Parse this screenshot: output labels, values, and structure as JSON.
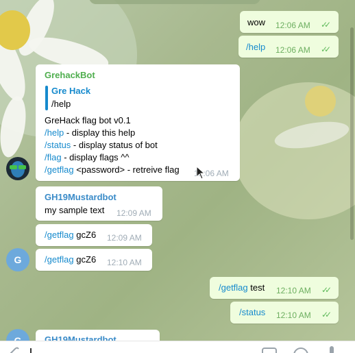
{
  "messages": {
    "out1": {
      "text": "wow",
      "time": "12:06 AM"
    },
    "out2": {
      "text": "/help",
      "time": "12:06 AM"
    },
    "bot_help": {
      "sender": "GrehackBot",
      "reply_sender": "Gre Hack",
      "reply_text": "/help",
      "title": "GreHack flag bot v0.1",
      "cmd1": "/help",
      "desc1": " - display this help",
      "cmd2": "/status",
      "desc2": " - display status of bot",
      "cmd3": "/flag",
      "desc3": " - display flags ^^",
      "cmd4": "/getflag",
      "desc4": " <password> - retreive flag",
      "time": "12:06 AM"
    },
    "in1": {
      "sender": "GH19Mustardbot",
      "text": "my sample text",
      "time": "12:09 AM"
    },
    "in2": {
      "cmd": "/getflag",
      "arg": " gcZ6",
      "time": "12:09 AM"
    },
    "in3": {
      "cmd": "/getflag",
      "arg": " gcZ6",
      "time": "12:10 AM"
    },
    "out3": {
      "cmd": "/getflag",
      "arg": " test",
      "time": "12:10 AM"
    },
    "out4": {
      "text": "/status",
      "time": "12:10 AM"
    },
    "in4": {
      "sender": "GH19Mustardbot"
    }
  },
  "avatars": {
    "g_letter": "G"
  },
  "colors": {
    "link": "#168acd",
    "bot_name": "#4fae4e",
    "user_name": "#3a8bc8",
    "out_bubble": "#effdde",
    "avatar_g": "#6da9dc"
  }
}
